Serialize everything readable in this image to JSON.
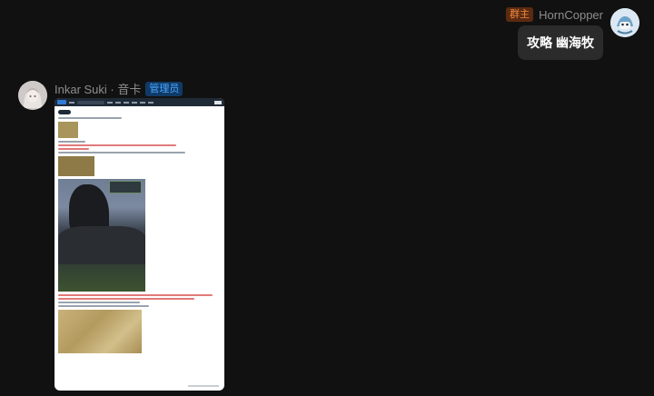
{
  "messages": {
    "right": {
      "role_badge": "群主",
      "sender": "HornCopper",
      "text": "攻略 幽海牧"
    },
    "left": {
      "sender": "Inkar Suki · 音卡",
      "role_badge": "管理员"
    }
  },
  "colors": {
    "background": "#111111",
    "bubble": "#2b2b2b",
    "owner_badge": "#f08a3c",
    "admin_badge": "#49a6ff"
  },
  "icons": {
    "right_avatar": "user-avatar-icon",
    "left_avatar": "user-avatar-icon"
  }
}
